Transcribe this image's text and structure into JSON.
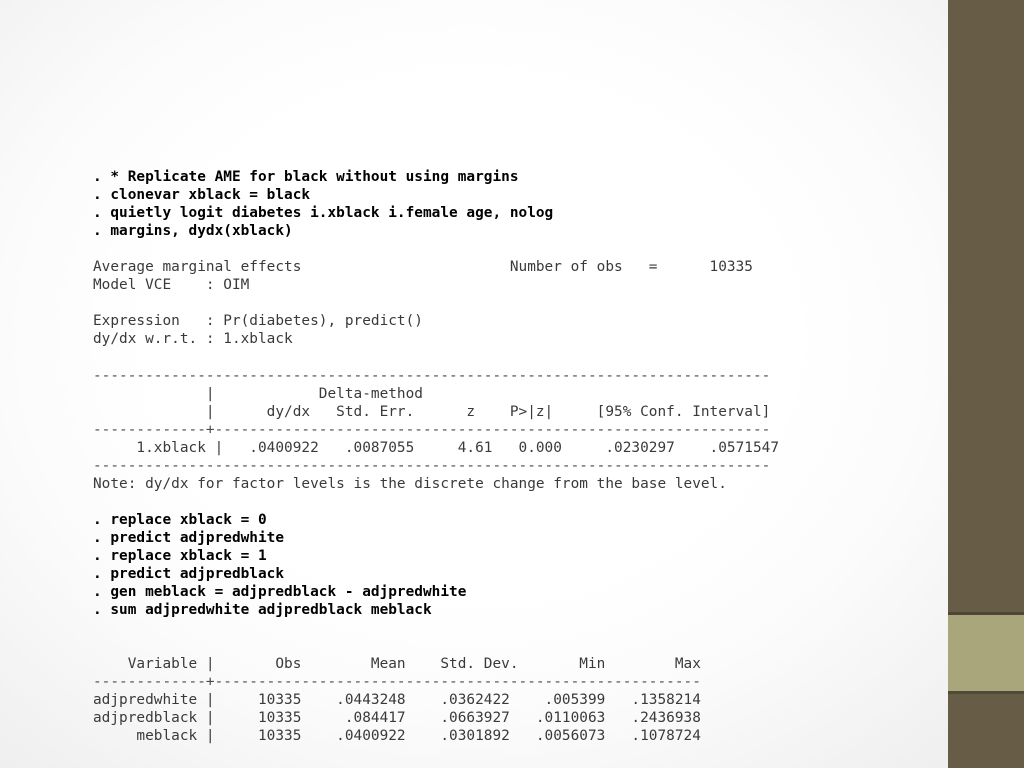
{
  "slide": {
    "theme": {
      "background_light": "#ffffff",
      "background_edge": "#ececed",
      "sidebar_color": "#675d46",
      "accent_block_color": "#aaa67c"
    }
  },
  "console": {
    "lines": [
      {
        "kind": "cmd",
        "text": ". * Replicate AME for black without using margins"
      },
      {
        "kind": "cmd",
        "text": ". clonevar xblack = black"
      },
      {
        "kind": "cmd",
        "text": ". quietly logit diabetes i.xblack i.female age, nolog"
      },
      {
        "kind": "cmd",
        "text": ". margins, dydx(xblack)"
      },
      {
        "kind": "blank",
        "text": ""
      },
      {
        "kind": "out",
        "text": "Average marginal effects                        Number of obs   =      10335"
      },
      {
        "kind": "out",
        "text": "Model VCE    : OIM"
      },
      {
        "kind": "blank",
        "text": ""
      },
      {
        "kind": "out",
        "text": "Expression   : Pr(diabetes), predict()"
      },
      {
        "kind": "out",
        "text": "dy/dx w.r.t. : 1.xblack"
      },
      {
        "kind": "blank",
        "text": ""
      },
      {
        "kind": "rule",
        "text": "------------------------------------------------------------------------------"
      },
      {
        "kind": "out",
        "text": "             |            Delta-method"
      },
      {
        "kind": "out",
        "text": "             |      dy/dx   Std. Err.      z    P>|z|     [95% Conf. Interval]"
      },
      {
        "kind": "rule",
        "text": "-------------+----------------------------------------------------------------"
      },
      {
        "kind": "out",
        "text": "     1.xblack |   .0400922   .0087055     4.61   0.000     .0230297    .0571547"
      },
      {
        "kind": "rule",
        "text": "------------------------------------------------------------------------------"
      },
      {
        "kind": "out",
        "text": "Note: dy/dx for factor levels is the discrete change from the base level."
      },
      {
        "kind": "blank",
        "text": ""
      },
      {
        "kind": "cmd",
        "text": ". replace xblack = 0"
      },
      {
        "kind": "cmd",
        "text": ". predict adjpredwhite"
      },
      {
        "kind": "cmd",
        "text": ". replace xblack = 1"
      },
      {
        "kind": "cmd",
        "text": ". predict adjpredblack"
      },
      {
        "kind": "cmd",
        "text": ". gen meblack = adjpredblack - adjpredwhite"
      },
      {
        "kind": "cmd",
        "text": ". sum adjpredwhite adjpredblack meblack"
      },
      {
        "kind": "blank",
        "text": ""
      },
      {
        "kind": "blank",
        "text": ""
      },
      {
        "kind": "out",
        "text": "    Variable |       Obs        Mean    Std. Dev.       Min        Max"
      },
      {
        "kind": "rule",
        "text": "-------------+--------------------------------------------------------"
      },
      {
        "kind": "out",
        "text": "adjpredwhite |     10335    .0443248    .0362422    .005399   .1358214"
      },
      {
        "kind": "out",
        "text": "adjpredblack |     10335     .084417    .0663927   .0110063   .2436938"
      },
      {
        "kind": "out",
        "text": "     meblack |     10335    .0400922    .0301892   .0056073   .1078724"
      }
    ],
    "margins_result": {
      "title": "Average marginal effects",
      "number_of_obs_label": "Number of obs",
      "number_of_obs": "10335",
      "model_vce_label": "Model VCE",
      "model_vce": "OIM",
      "expression_label": "Expression",
      "expression": "Pr(diabetes), predict()",
      "dydx_wrt_label": "dy/dx w.r.t.",
      "dydx_wrt": "1.xblack",
      "std_err_type": "Delta-method",
      "columns": [
        "",
        "dy/dx",
        "Std. Err.",
        "z",
        "P>|z|",
        "[95% Conf. Interval]"
      ],
      "rows": [
        {
          "variable": "1.xblack",
          "dydx": ".0400922",
          "std_err": ".0087055",
          "z": "4.61",
          "p": "0.000",
          "ci_low": ".0230297",
          "ci_high": ".0571547"
        }
      ],
      "note": "Note: dy/dx for factor levels is the discrete change from the base level."
    },
    "summary_table": {
      "columns": [
        "Variable",
        "Obs",
        "Mean",
        "Std. Dev.",
        "Min",
        "Max"
      ],
      "rows": [
        {
          "variable": "adjpredwhite",
          "obs": "10335",
          "mean": ".0443248",
          "std_dev": ".0362422",
          "min": ".005399",
          "max": ".1358214"
        },
        {
          "variable": "adjpredblack",
          "obs": "10335",
          "mean": ".084417",
          "std_dev": ".0663927",
          "min": ".0110063",
          "max": ".2436938"
        },
        {
          "variable": "meblack",
          "obs": "10335",
          "mean": ".0400922",
          "std_dev": ".0301892",
          "min": ".0056073",
          "max": ".1078724"
        }
      ]
    }
  }
}
